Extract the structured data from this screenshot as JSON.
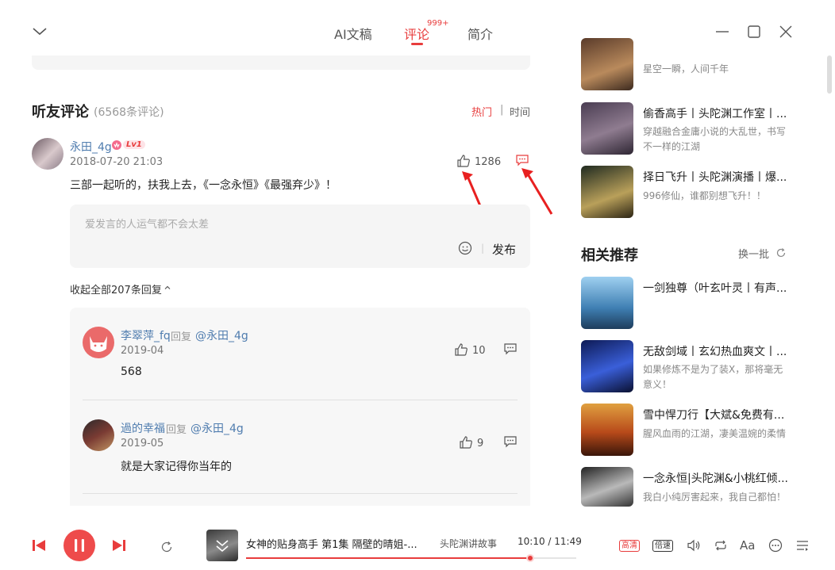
{
  "header": {
    "tabs": [
      {
        "label": "AI文稿"
      },
      {
        "label": "评论",
        "badge": "999+"
      },
      {
        "label": "简介"
      }
    ]
  },
  "comments": {
    "title": "听友评论",
    "count": "(6568条评论)",
    "sort_hot": "热门",
    "sort_time": "时间",
    "main": {
      "user": "永田_4g",
      "level": "Lv1",
      "time": "2018-07-20 21:03",
      "likes": "1286",
      "text": "三部一起听的，扶我上去，《一念永恒》《最强弃少》！"
    },
    "input_placeholder": "爱发言的人运气都不会太差",
    "publish_label": "发布",
    "collapse_label": "收起全部207条回复",
    "replies": [
      {
        "user": "李翠萍_fq",
        "verb": "回复",
        "target": "@永田_4g",
        "time": "2019-04",
        "likes": "10",
        "text": "568"
      },
      {
        "user": "過的幸福",
        "verb": "回复",
        "target": "@永田_4g",
        "time": "2019-05",
        "likes": "9",
        "text": "就是大家记得你当年的"
      }
    ]
  },
  "sidebar": {
    "top_items": [
      {
        "title": "",
        "desc": "星空一瞬，人间千年"
      },
      {
        "title": "偷香高手丨头陀渊工作室丨...",
        "desc": "穿越融合金庸小说的大乱世，书写不一样的江湖"
      },
      {
        "title": "择日飞升丨头陀渊演播丨爆...",
        "desc": "996修仙，谁都别想飞升！！"
      }
    ],
    "rec_title": "相关推荐",
    "refresh_label": "换一批",
    "rec_items": [
      {
        "title": "一剑独尊（叶玄叶灵丨有声...",
        "desc": ""
      },
      {
        "title": "无敌剑域丨玄幻热血爽文丨...",
        "desc": "如果修炼不是为了装X，那将毫无意义！"
      },
      {
        "title": "雪中悍刀行【大斌&免费有...",
        "desc": "腥风血雨的江湖，凄美温婉的柔情"
      },
      {
        "title": "一念永恒|头陀渊&小桃红倾...",
        "desc": "我白小纯厉害起来，我自己都怕！"
      }
    ]
  },
  "player": {
    "title": "女神的贴身高手 第1集 隔壁的晴姐-...",
    "author": "头陀渊讲故事",
    "time": "10:10 / 11:49",
    "progress": 0.86,
    "quality_label": "高清",
    "speed_label": "倍速",
    "font_label": "Aa"
  },
  "colors": {
    "accent": "#e83c3c",
    "username": "#507daf"
  }
}
